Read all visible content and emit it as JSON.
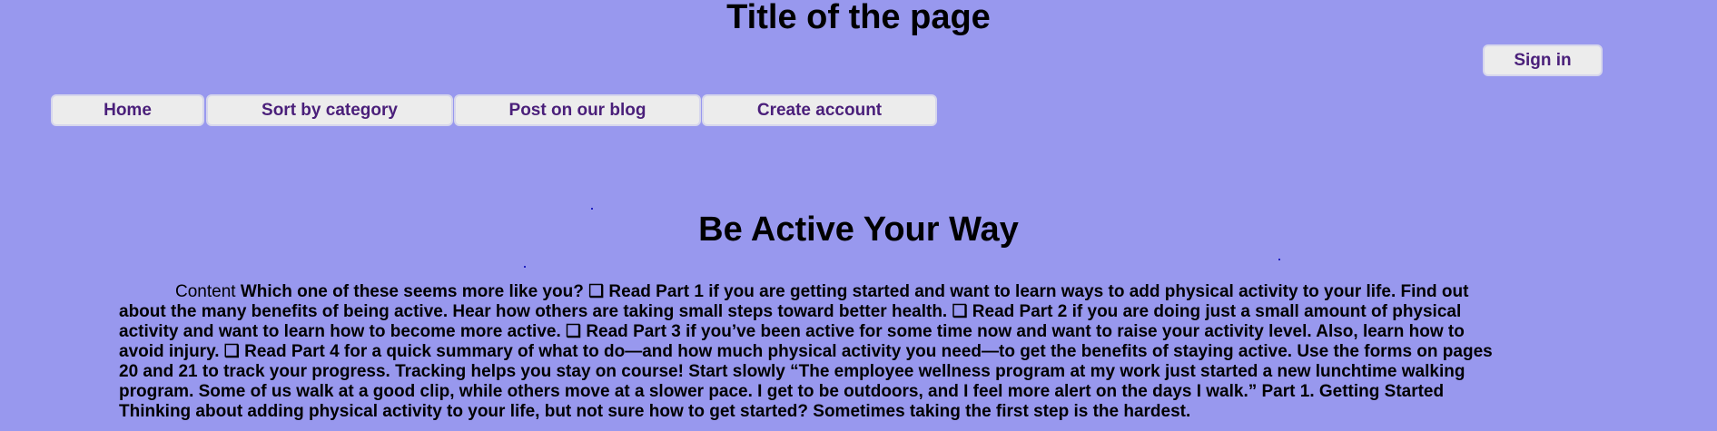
{
  "header": {
    "title": "Title of the page",
    "sign_in_label": "Sign in"
  },
  "nav": {
    "items": [
      {
        "label": "Home"
      },
      {
        "label": "Sort by category"
      },
      {
        "label": "Post on our blog"
      },
      {
        "label": "Create account"
      }
    ]
  },
  "main": {
    "heading": "Be Active Your Way",
    "content_label": "Content",
    "content_text": "Which one of these seems more like you? ❑ Read Part 1 if you are getting started and want to learn ways to add physical activity to your life. Find out about the many benefits of being active. Hear how others are taking small steps toward better health. ❑ Read Part 2 if you are doing just a small amount of physical activity and want to learn how to become more active. ❑ Read Part 3 if you’ve been active for some time now and want to raise your activity level. Also, learn how to avoid injury. ❑ Read Part 4 for a quick summary of what to do—and how much physical activity you need—to get the benefits of staying active. Use the forms on pages 20 and 21 to track your progress. Tracking helps you stay on course! Start slowly “The employee wellness program at my work just started a new lunchtime walking program. Some of us walk at a good clip, while others move at a slower pace. I get to be outdoors, and I feel more alert on the days I walk.” Part 1. Getting Started Thinking about adding physical activity to your life, but not sure how to get started? Sometimes taking the first step is the hardest."
  },
  "colors": {
    "background": "#9898ee",
    "button_background": "#ececec",
    "button_text": "#4a1f7a"
  }
}
